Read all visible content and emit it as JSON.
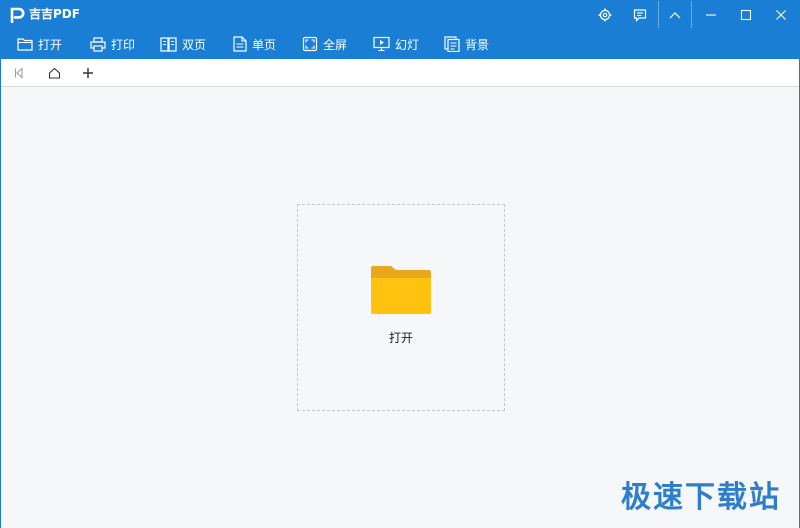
{
  "app": {
    "title": "吉吉PDF"
  },
  "titlebar": {
    "icons": [
      "gear-icon",
      "feedback-icon",
      "collapse-icon",
      "minimize-icon",
      "maximize-icon",
      "close-icon"
    ]
  },
  "toolbar": {
    "open": "打开",
    "print": "打印",
    "double": "双页",
    "single": "单页",
    "fullscreen": "全屏",
    "slideshow": "幻灯",
    "background": "背景"
  },
  "main": {
    "open_label": "打开"
  },
  "watermark": "极速下载站",
  "colors": {
    "accent": "#1a7fd4",
    "folder": "#ffc20e",
    "folder_tab": "#e8a81e",
    "watermark": "#1e74c8"
  }
}
